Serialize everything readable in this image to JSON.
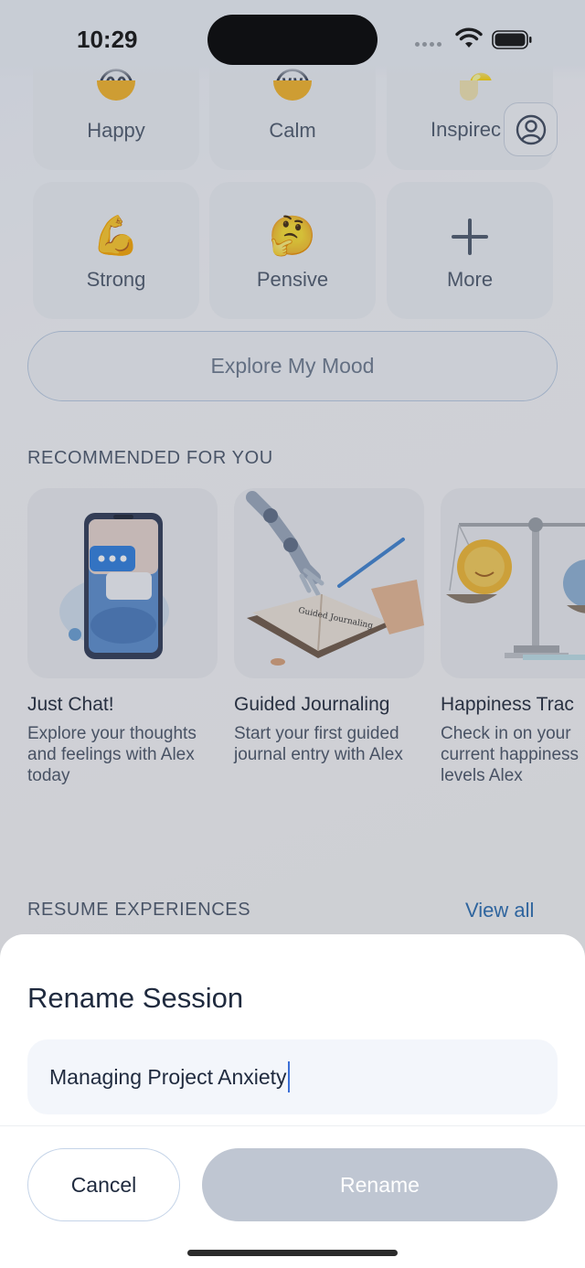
{
  "status_bar": {
    "time": "10:29"
  },
  "moods": [
    {
      "label": "Happy",
      "emoji": "😊",
      "icon": "smiling-face-icon"
    },
    {
      "label": "Calm",
      "emoji": "😌",
      "icon": "relieved-face-icon"
    },
    {
      "label": "Inspirec",
      "emoji": "💡",
      "icon": "lightbulb-icon"
    },
    {
      "label": "Strong",
      "emoji": "💪",
      "icon": "flexed-biceps-icon"
    },
    {
      "label": "Pensive",
      "emoji": "🤔",
      "icon": "thinking-face-icon"
    },
    {
      "label": "More",
      "icon": "plus-icon"
    }
  ],
  "explore_button": "Explore My Mood",
  "recommended": {
    "title": "RECOMMENDED FOR YOU",
    "cards": [
      {
        "title": "Just Chat!",
        "description": "Explore your thoughts and feelings with Alex today",
        "image": "phone-chat-illustration"
      },
      {
        "title": "Guided Journaling",
        "description": "Start your first guided journal entry with Alex",
        "image": "robot-hand-journal-illustration",
        "image_text": "Guided Journaling"
      },
      {
        "title": "Happiness Trac",
        "description": "Check in on your current happiness levels Alex",
        "image": "scale-sun-illustration"
      }
    ]
  },
  "resume": {
    "title": "RESUME EXPERIENCES",
    "view_all": "View all"
  },
  "rename_sheet": {
    "title": "Rename Session",
    "input_value": "Managing Project Anxiety",
    "cancel_label": "Cancel",
    "rename_label": "Rename"
  }
}
